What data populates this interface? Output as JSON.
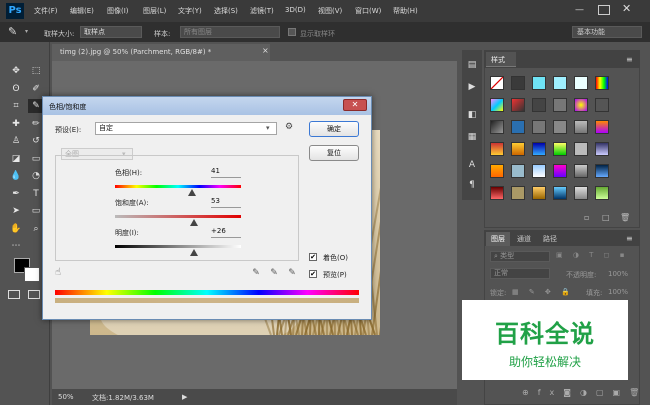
{
  "app": {
    "logo": "Ps"
  },
  "menubar": {
    "items": [
      "文件(F)",
      "编辑(E)",
      "图像(I)",
      "图层(L)",
      "文字(Y)",
      "选择(S)",
      "滤镜(T)",
      "3D(D)",
      "视图(V)",
      "窗口(W)",
      "帮助(H)"
    ],
    "min_glyph": "—",
    "close_glyph": "✕"
  },
  "optionsbar": {
    "sample_size_label": "取样大小:",
    "sample_size_value": "取样点",
    "sample_label": "样本:",
    "sample_value": "所有图层",
    "show_ring_label": "显示取样环",
    "workspace": "基本功能"
  },
  "document": {
    "tab_title": "timg (2).jpg @ 50% (Parchment, RGB/8#) *",
    "zoom": "50%",
    "doc_info": "文档:1.82M/3.63M"
  },
  "styles_panel": {
    "title": "样式"
  },
  "layers_panel": {
    "tabs": [
      "图层",
      "通道",
      "路径"
    ],
    "kind_label": "类型",
    "blend_mode": "正常",
    "opacity_label": "不透明度:",
    "opacity_value": "100%",
    "lock_label": "锁定:",
    "fill_label": "填充:",
    "fill_value": "100%"
  },
  "dialog": {
    "title": "色相/饱和度",
    "preset_label": "预设(E):",
    "preset_value": "自定",
    "ok_label": "确定",
    "reset_label": "复位",
    "channel_value": "全图",
    "hue": {
      "label": "色相(H):",
      "value": "41",
      "fraction": 0.61
    },
    "saturation": {
      "label": "饱和度(A):",
      "value": "53",
      "fraction": 0.63
    },
    "lightness": {
      "label": "明度(I):",
      "value": "+26",
      "fraction": 0.63
    },
    "colorize": {
      "label": "着色(O)",
      "checked": true
    },
    "preview": {
      "label": "预览(P)",
      "checked": true
    }
  },
  "watermark": {
    "title": "百科全说",
    "subtitle": "助你轻松解决"
  }
}
